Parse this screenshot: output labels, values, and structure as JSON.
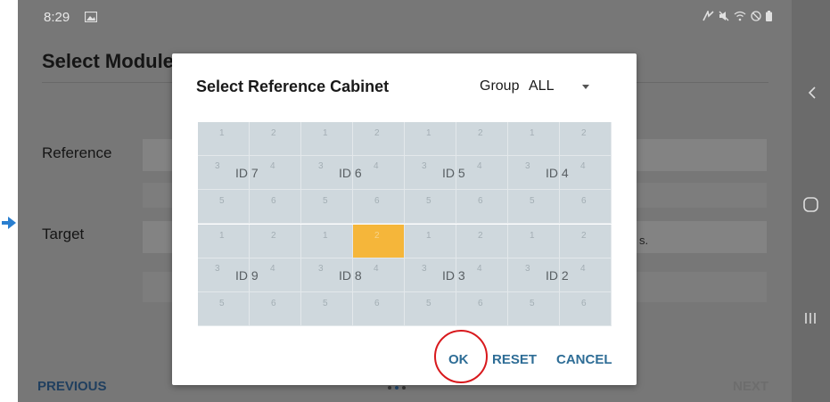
{
  "status_bar": {
    "time": "8:29",
    "icons": [
      "gallery-icon",
      "nfc-icon",
      "mute-icon",
      "wifi-icon",
      "do-not-disturb-icon",
      "battery-icon"
    ]
  },
  "page": {
    "title": "Select Module",
    "reference_label": "Reference",
    "target_label": "Target",
    "hint_fragment": "s.",
    "previous_label": "PREVIOUS",
    "next_label": "NEXT",
    "page_indicator": {
      "count": 3,
      "active": 1
    }
  },
  "dialog": {
    "title": "Select Reference Cabinet",
    "group_label": "Group",
    "group_value": "ALL",
    "cabinets": [
      {
        "id_label": "ID 7",
        "modules": [
          "1",
          "2",
          "3",
          "4",
          "5",
          "6"
        ],
        "selected_module": null
      },
      {
        "id_label": "ID 6",
        "modules": [
          "1",
          "2",
          "3",
          "4",
          "5",
          "6"
        ],
        "selected_module": null
      },
      {
        "id_label": "ID 5",
        "modules": [
          "1",
          "2",
          "3",
          "4",
          "5",
          "6"
        ],
        "selected_module": null
      },
      {
        "id_label": "ID 4",
        "modules": [
          "1",
          "2",
          "3",
          "4",
          "5",
          "6"
        ],
        "selected_module": null
      },
      {
        "id_label": "ID 9",
        "modules": [
          "1",
          "2",
          "3",
          "4",
          "5",
          "6"
        ],
        "selected_module": null
      },
      {
        "id_label": "ID 8",
        "modules": [
          "1",
          "2",
          "3",
          "4",
          "5",
          "6"
        ],
        "selected_module": 1
      },
      {
        "id_label": "ID 3",
        "modules": [
          "1",
          "2",
          "3",
          "4",
          "5",
          "6"
        ],
        "selected_module": null
      },
      {
        "id_label": "ID 2",
        "modules": [
          "1",
          "2",
          "3",
          "4",
          "5",
          "6"
        ],
        "selected_module": null
      }
    ],
    "buttons": {
      "ok": "OK",
      "reset": "RESET",
      "cancel": "CANCEL"
    }
  },
  "colors": {
    "accent": "#2e6d96",
    "selected_module": "#f5b63a",
    "grid_background": "#cfd8dd",
    "annotation_circle": "#d8191d"
  }
}
